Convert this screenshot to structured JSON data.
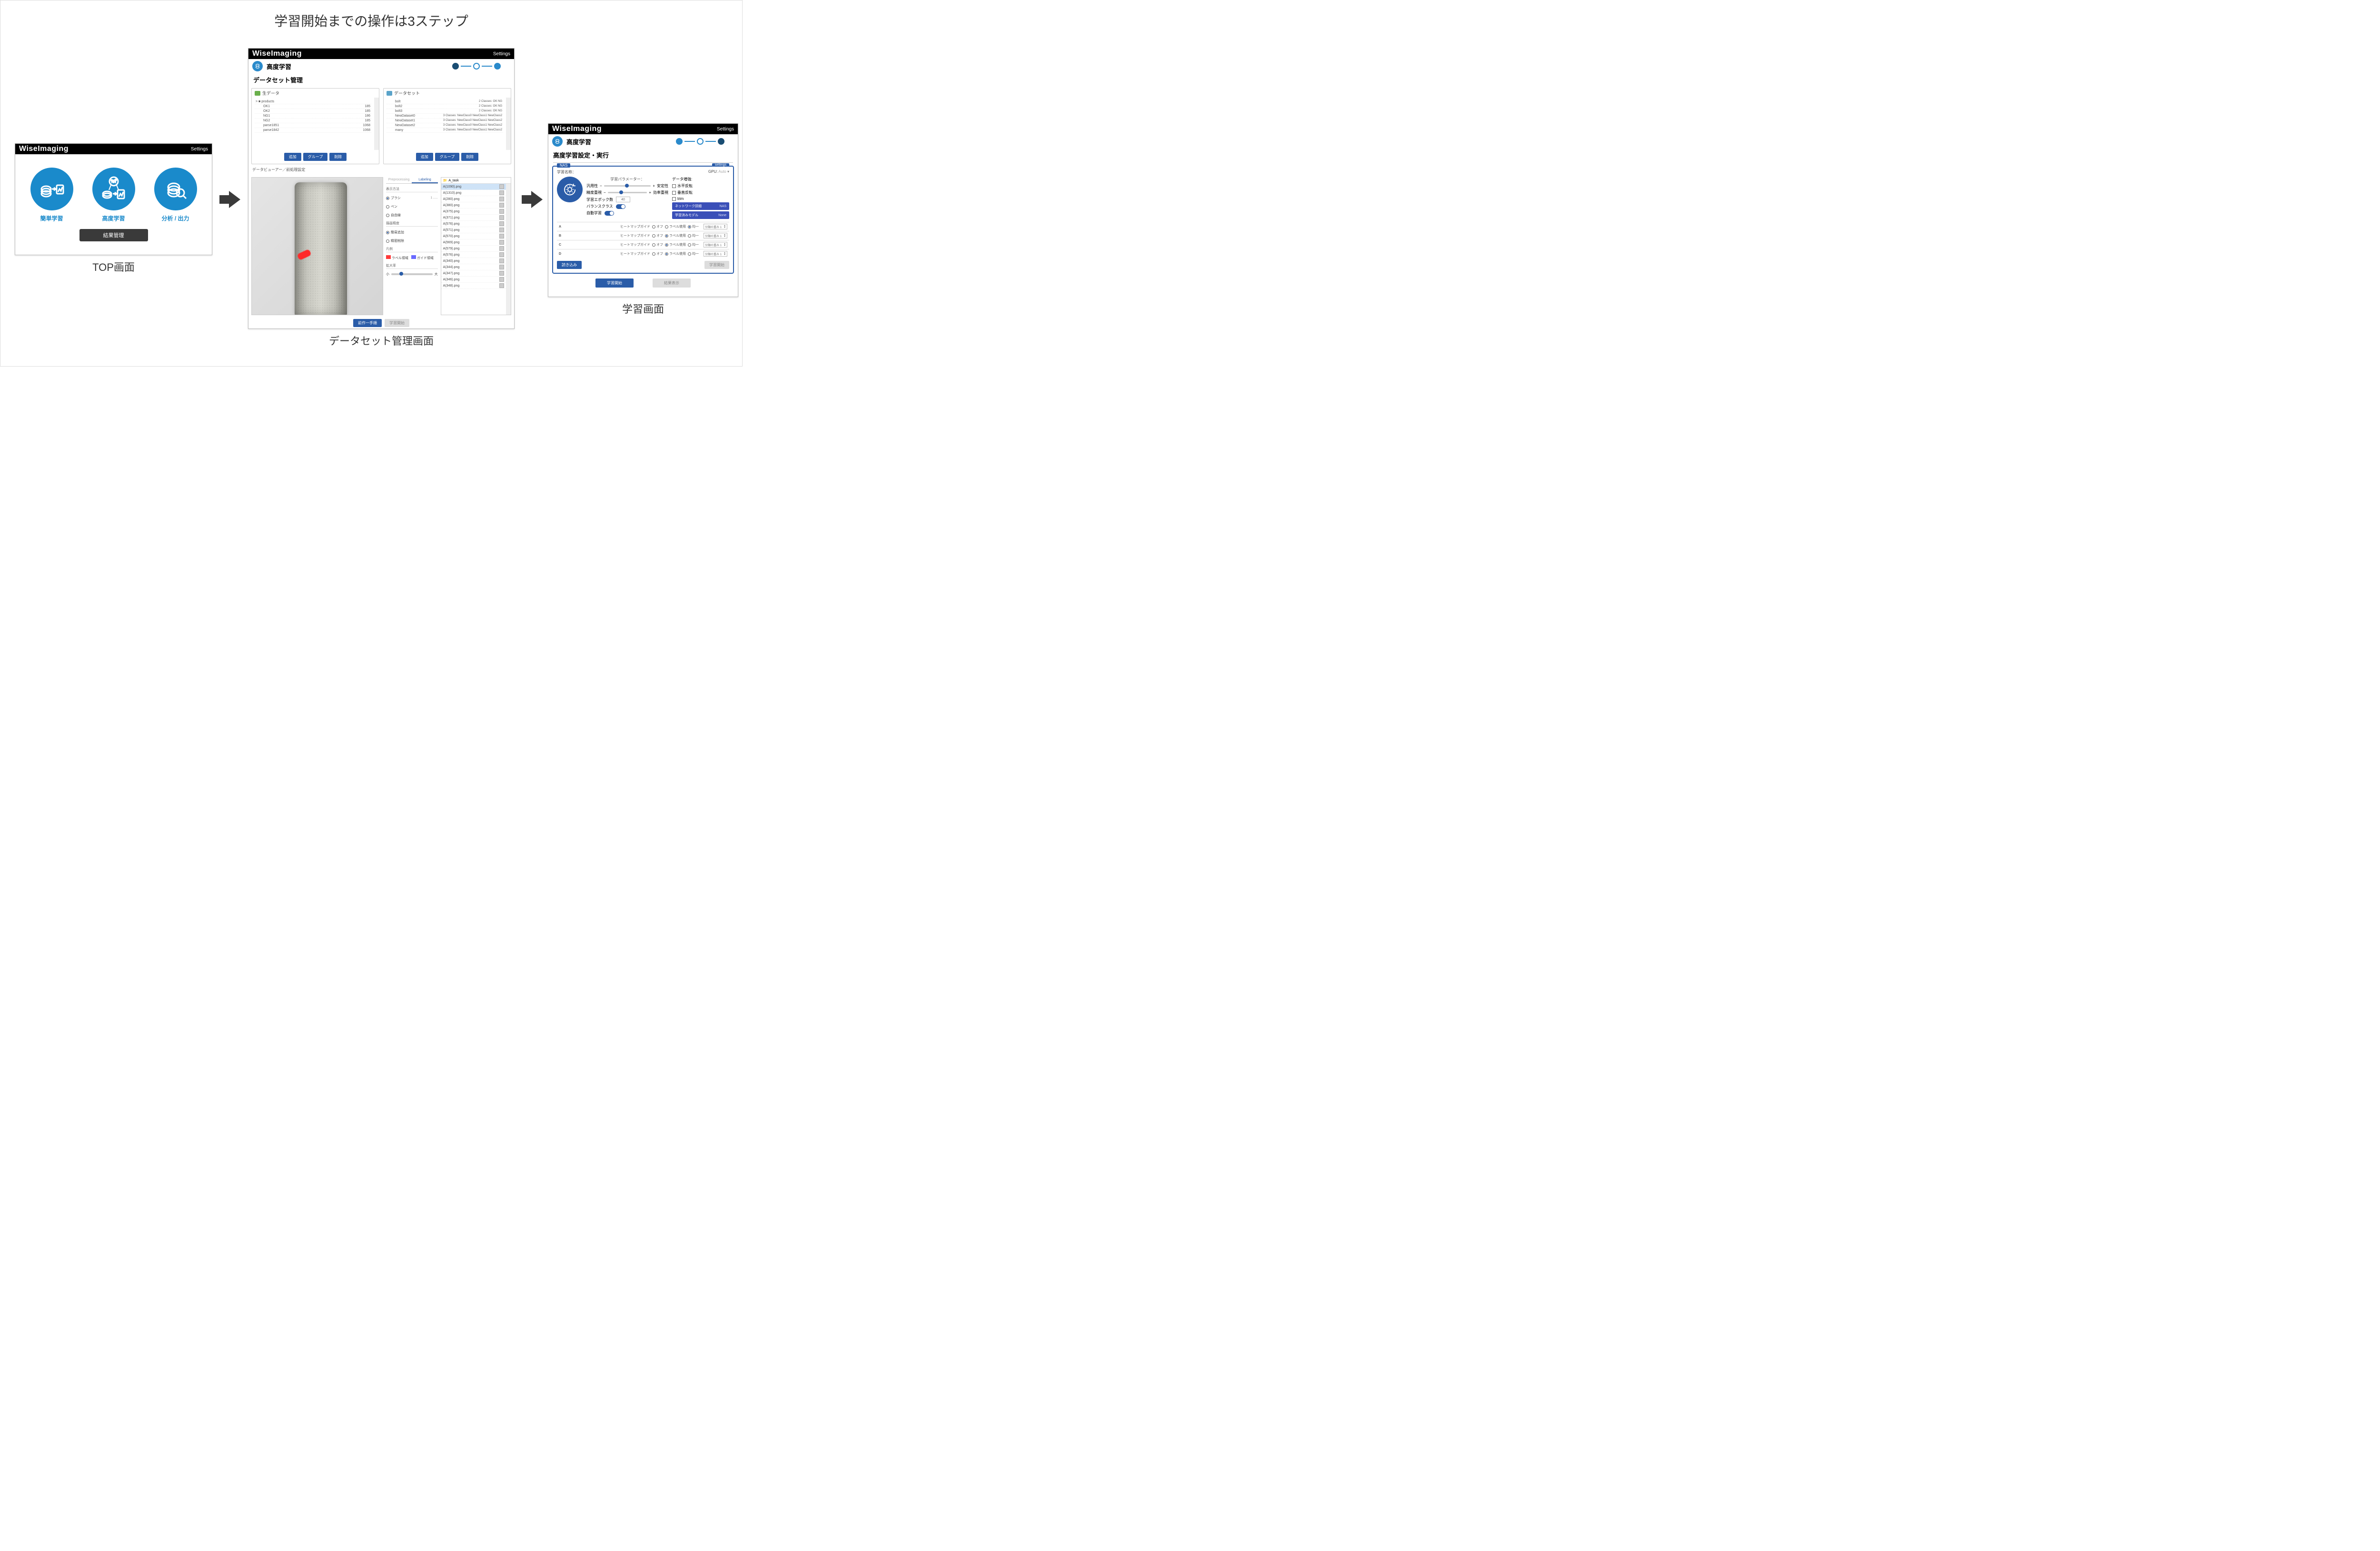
{
  "heading": "学習開始までの操作は3ステップ",
  "brand": "WiseImaging",
  "settings_label": "Settings",
  "captions": {
    "top": "TOP画面",
    "dataset": "データセット管理画面",
    "learn": "学習画面"
  },
  "top": {
    "items": [
      {
        "id": "easy-learn",
        "label": "簡単学習"
      },
      {
        "id": "adv-learn",
        "label": "高度学習"
      },
      {
        "id": "analysis",
        "label": "分析 / 出力"
      }
    ],
    "result_button": "結果管理"
  },
  "ds": {
    "page_title": "高度学習",
    "section_title": "データセット管理",
    "raw_panel_title": "生データ",
    "dataset_panel_title": "データセット",
    "raw_rows": [
      {
        "name": "> ■ products",
        "meta": ""
      },
      {
        "name": "OK1",
        "meta": "185"
      },
      {
        "name": "OK2",
        "meta": "185"
      },
      {
        "name": "NG1",
        "meta": "186"
      },
      {
        "name": "NG2",
        "meta": "185"
      },
      {
        "name": "parse1851",
        "meta": "1068"
      },
      {
        "name": "parse1842",
        "meta": "1068"
      }
    ],
    "dataset_rows": [
      {
        "name": "bolt",
        "meta": "2 Classes: OK NG"
      },
      {
        "name": "bolt2",
        "meta": "2 Classes: OK NG"
      },
      {
        "name": "bolt3",
        "meta": "2 Classes: OK NG"
      },
      {
        "name": "NewDataset0",
        "meta": "3 Classes: NewClass0 NewClass1 NewClass2"
      },
      {
        "name": "NewDataset1",
        "meta": "3 Classes: NewClass0 NewClass1 NewClass2"
      },
      {
        "name": "NewDataset2",
        "meta": "3 Classes: NewClass0 NewClass1 NewClass2"
      },
      {
        "name": "many",
        "meta": "3 Classes: NewClass0 NewClass1 NewClass2"
      }
    ],
    "panel_buttons": {
      "add": "追加",
      "group": "グループ",
      "delete": "削除"
    },
    "viewer_title": "データビューアー／前処理設定",
    "tabs": {
      "pre": "Preprocessing",
      "label": "Labeling"
    },
    "controls": {
      "display_head": "表示方法",
      "display_opts": [
        "ブラシ",
        "ペン",
        "自由線"
      ],
      "cut_head": "描画精度",
      "cut_opts": [
        "簡易追加",
        "精密削除"
      ],
      "desc_head": "凡例",
      "label_area": "ラベル領域",
      "guide_area": "ガイド領域",
      "size_head": "拡大率",
      "size_small": "小",
      "size_large": "大"
    },
    "film_folder": "A_task",
    "film_rows": [
      "A(1090).png",
      "A(1310).png",
      "A(280).png",
      "A(380).png",
      "A(375).png",
      "A(371).png",
      "A(576).png",
      "A(571).png",
      "A(570).png",
      "A(569).png",
      "A(579).png",
      "A(576).png",
      "A(340).png",
      "A(344).png",
      "A(347).png",
      "A(346).png",
      "A(348).png"
    ],
    "footer_buttons": {
      "prev": "前作一手順",
      "start": "学習開始"
    }
  },
  "learn": {
    "page_title": "高度学習",
    "section_title": "高度学習設定・実行",
    "nas_tag": "NAS",
    "nas_settings": "settings",
    "name_label": "学習名称：",
    "gpu_label": "GPU:",
    "gpu_value": "Auto",
    "param_head": "学習パラメーター：",
    "slider1": {
      "left": "汎用性",
      "right": "安定性"
    },
    "slider2": {
      "left": "精度重視",
      "right": "効率重視"
    },
    "epoch_label": "学習エポック数",
    "epoch_value": "40",
    "balance_label": "バランスクラス",
    "auto_label": "自動学習",
    "aug_head": "データ増強:",
    "augs": [
      "水平反転",
      "垂直反転",
      "trim"
    ],
    "net_btn": "ネットワーク詳細",
    "net_tag": "NAS",
    "model_btn": "学習済みモデル",
    "model_tag": "None",
    "class_names": [
      "A",
      "B",
      "C",
      "D"
    ],
    "heatmap_label": "ヒートマップガイド",
    "radio_opts": [
      "オフ",
      "ラベル使用",
      "均一"
    ],
    "weight_label": "分類の重み",
    "weight_value": "1",
    "load_btn": "読き込み",
    "learn_grey": "学習開始",
    "footer_start": "学習開始",
    "footer_result": "結果表示"
  }
}
